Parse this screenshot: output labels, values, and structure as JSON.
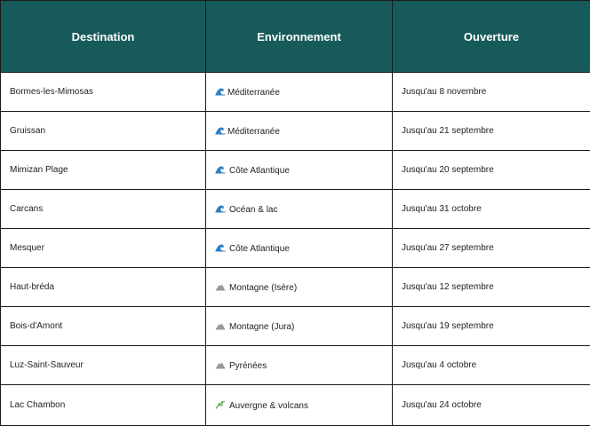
{
  "table": {
    "headers": [
      "Destination",
      "Environnement",
      "Ouverture"
    ],
    "rows": [
      {
        "destination": "Bormes-les-Mimosas",
        "icon": "wave-icon",
        "environment": "Méditerranée",
        "opening": "Jusqu'au 8 novembre"
      },
      {
        "destination": "Gruissan",
        "icon": "wave-icon",
        "environment": "Méditerranée",
        "opening": "Jusqu'au 21 septembre"
      },
      {
        "destination": "Mimizan Plage",
        "icon": "wave-icon",
        "environment": "Côte Atlantique",
        "opening": "Jusqu'au 20 septembre"
      },
      {
        "destination": "Carcans",
        "icon": "wave-icon",
        "environment": "Océan & lac",
        "opening": "Jusqu'au 31 octobre"
      },
      {
        "destination": "Mesquer",
        "icon": "wave-icon",
        "environment": "Côte Atlantique",
        "opening": "Jusqu'au 27 septembre"
      },
      {
        "destination": "Haut-bréda",
        "icon": "mountain-icon",
        "environment": "Montagne (Isère)",
        "opening": "Jusqu'au 12 septembre"
      },
      {
        "destination": "Bois-d'Amont",
        "icon": "mountain-icon",
        "environment": "Montagne (Jura)",
        "opening": "Jusqu'au 19 septembre"
      },
      {
        "destination": "Luz-Saint-Sauveur",
        "icon": "mountain-icon",
        "environment": "Pyrénées",
        "opening": "Jusqu'au 4 octobre"
      },
      {
        "destination": "Lac Chambon",
        "icon": "herb-icon",
        "environment": "Auvergne & volcans",
        "opening": "Jusqu'au 24 octobre"
      }
    ]
  },
  "colors": {
    "header_bg": "#175a5a",
    "header_text": "#ffffff",
    "border": "#1a1a1a",
    "wave": "#2f7fc1",
    "mountain": "#9a9a92",
    "herb": "#4a9a3a"
  }
}
